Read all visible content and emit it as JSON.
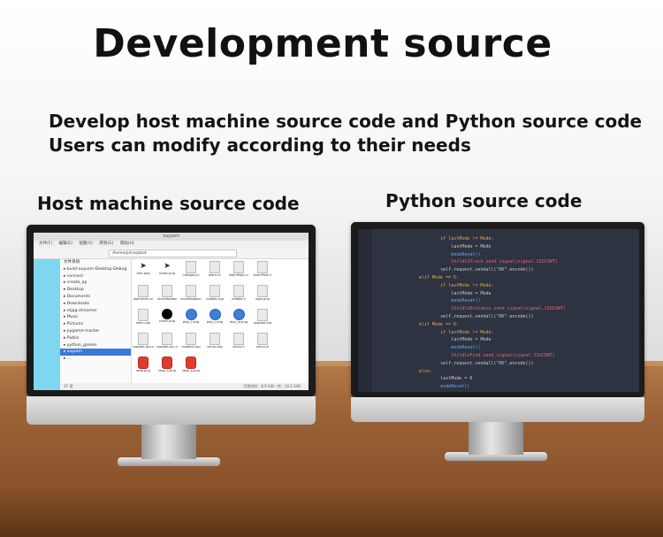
{
  "heading": "Development source",
  "subheadings": [
    "Develop host machine source code and Python source code",
    "Users can modify according to their needs"
  ],
  "labels": {
    "left": "Host machine source code",
    "right": "Python source code"
  },
  "file_manager": {
    "window_title": "oujuom",
    "menu": [
      "文件(F)",
      "编辑(E)",
      "视图(V)",
      "转到(G)",
      "帮助(H)"
    ],
    "path": "/home/pi/raspbot",
    "tree": [
      "文件系统",
      "build-oujuom-Desktop-Debug",
      "connect",
      "create_ap",
      "Desktop",
      "Documents",
      "Downloads",
      "mjpg-streamer",
      "Music",
      "Pictures",
      "pygame-master",
      "Public",
      "python_games",
      "oujuom",
      "..."
    ],
    "selected_index": 13,
    "files": [
      {
        "name": "arm.png",
        "kind": "arrow"
      },
      {
        "name": "index.png",
        "kind": "arrow"
      },
      {
        "name": "Category.h",
        "kind": "doc"
      },
      {
        "name": "learn.cc",
        "kind": "doc"
      },
      {
        "name": "learnMain.cc",
        "kind": "doc"
      },
      {
        "name": "learnMain.h",
        "kind": "doc"
      },
      {
        "name": "learnmain.ui",
        "kind": "doc"
      },
      {
        "name": "recombobox",
        "kind": "doc"
      },
      {
        "name": "recombobox.h",
        "kind": "doc"
      },
      {
        "name": "relable.cpp",
        "kind": "doc"
      },
      {
        "name": "relable.h",
        "kind": "doc"
      },
      {
        "name": "logo.png",
        "kind": "doc"
      },
      {
        "name": "main.cpp",
        "kind": "doc"
      },
      {
        "name": "mesh.png",
        "kind": "black"
      },
      {
        "name": "play_l.png",
        "kind": "blue"
      },
      {
        "name": "play_r.png",
        "kind": "blue"
      },
      {
        "name": "play_w.png",
        "kind": "blue"
      },
      {
        "name": "raspbot.pro",
        "kind": "doc"
      },
      {
        "name": "raspbot.pro.user",
        "kind": "doc"
      },
      {
        "name": "raspbot.pro.user.AD0",
        "kind": "doc"
      },
      {
        "name": "raspbot.cpp",
        "kind": "doc"
      },
      {
        "name": "servo.cpp",
        "kind": "doc"
      },
      {
        "name": "servo.h",
        "kind": "doc"
      },
      {
        "name": "servo.ui",
        "kind": "doc"
      },
      {
        "name": "stop.png",
        "kind": "red"
      },
      {
        "name": "stop_h.png",
        "kind": "red"
      },
      {
        "name": "stop_p.png",
        "kind": "red"
      }
    ],
    "status_left": "27 项",
    "status_right": "可用空间：8.9 GiB（共：14.5 GiB）"
  },
  "code": {
    "lines": [
      {
        "indent": 12,
        "tokens": [
          [
            "if lastMode != Mode:",
            "#e0a85a"
          ]
        ]
      },
      {
        "indent": 14,
        "tokens": [
          [
            "lastMode = Mode",
            "#c8ccd4"
          ]
        ]
      },
      {
        "indent": 14,
        "tokens": [
          [
            "modeReset()",
            "#6aa8f0"
          ]
        ]
      },
      {
        "indent": 14,
        "tokens": [
          [
            "ChildCoTrack.send_signal(signal.SIGCONT)",
            "#e06c75"
          ]
        ]
      },
      {
        "indent": 12,
        "tokens": [
          [
            "self.request.sendall(\"OK\".encode())",
            "#c8ccd4"
          ]
        ]
      },
      {
        "indent": 8,
        "tokens": [
          [
            "elif Mode == 5:",
            "#e0a85a"
          ]
        ]
      },
      {
        "indent": 12,
        "tokens": [
          [
            "if lastMode != Mode:",
            "#e0a85a"
          ]
        ]
      },
      {
        "indent": 14,
        "tokens": [
          [
            "lastMode = Mode",
            "#c8ccd4"
          ]
        ]
      },
      {
        "indent": 14,
        "tokens": [
          [
            "modeReset()",
            "#6aa8f0"
          ]
        ]
      },
      {
        "indent": 14,
        "tokens": [
          [
            "ChildCoDistance.send_signal(signal.SIGCONT)",
            "#e06c75"
          ]
        ]
      },
      {
        "indent": 12,
        "tokens": [
          [
            "self.request.sendall(\"OK\".encode())",
            "#c8ccd4"
          ]
        ]
      },
      {
        "indent": 8,
        "tokens": [
          [
            "elif Mode == 6:",
            "#e0a85a"
          ]
        ]
      },
      {
        "indent": 12,
        "tokens": [
          [
            "if lastMode != Mode:",
            "#e0a85a"
          ]
        ]
      },
      {
        "indent": 14,
        "tokens": [
          [
            "lastMode = Mode",
            "#c8ccd4"
          ]
        ]
      },
      {
        "indent": 14,
        "tokens": [
          [
            "modeReset()",
            "#6aa8f0"
          ]
        ]
      },
      {
        "indent": 14,
        "tokens": [
          [
            "ChildCoFind.send_signal(signal.SIGCONT)",
            "#e06c75"
          ]
        ]
      },
      {
        "indent": 12,
        "tokens": [
          [
            "self.request.sendall(\"OK\".encode())",
            "#c8ccd4"
          ]
        ]
      },
      {
        "indent": 8,
        "tokens": [
          [
            "else:",
            "#e0a85a"
          ]
        ]
      },
      {
        "indent": 12,
        "tokens": [
          [
            "lastMode = 0",
            "#c8ccd4"
          ]
        ]
      },
      {
        "indent": 12,
        "tokens": [
          [
            "modeReset()",
            "#6aa8f0"
          ]
        ]
      }
    ]
  },
  "colors": {
    "code_bg": "#2d3340",
    "file_side_accent": "#7fd6ef",
    "selection": "#3b78d8"
  }
}
